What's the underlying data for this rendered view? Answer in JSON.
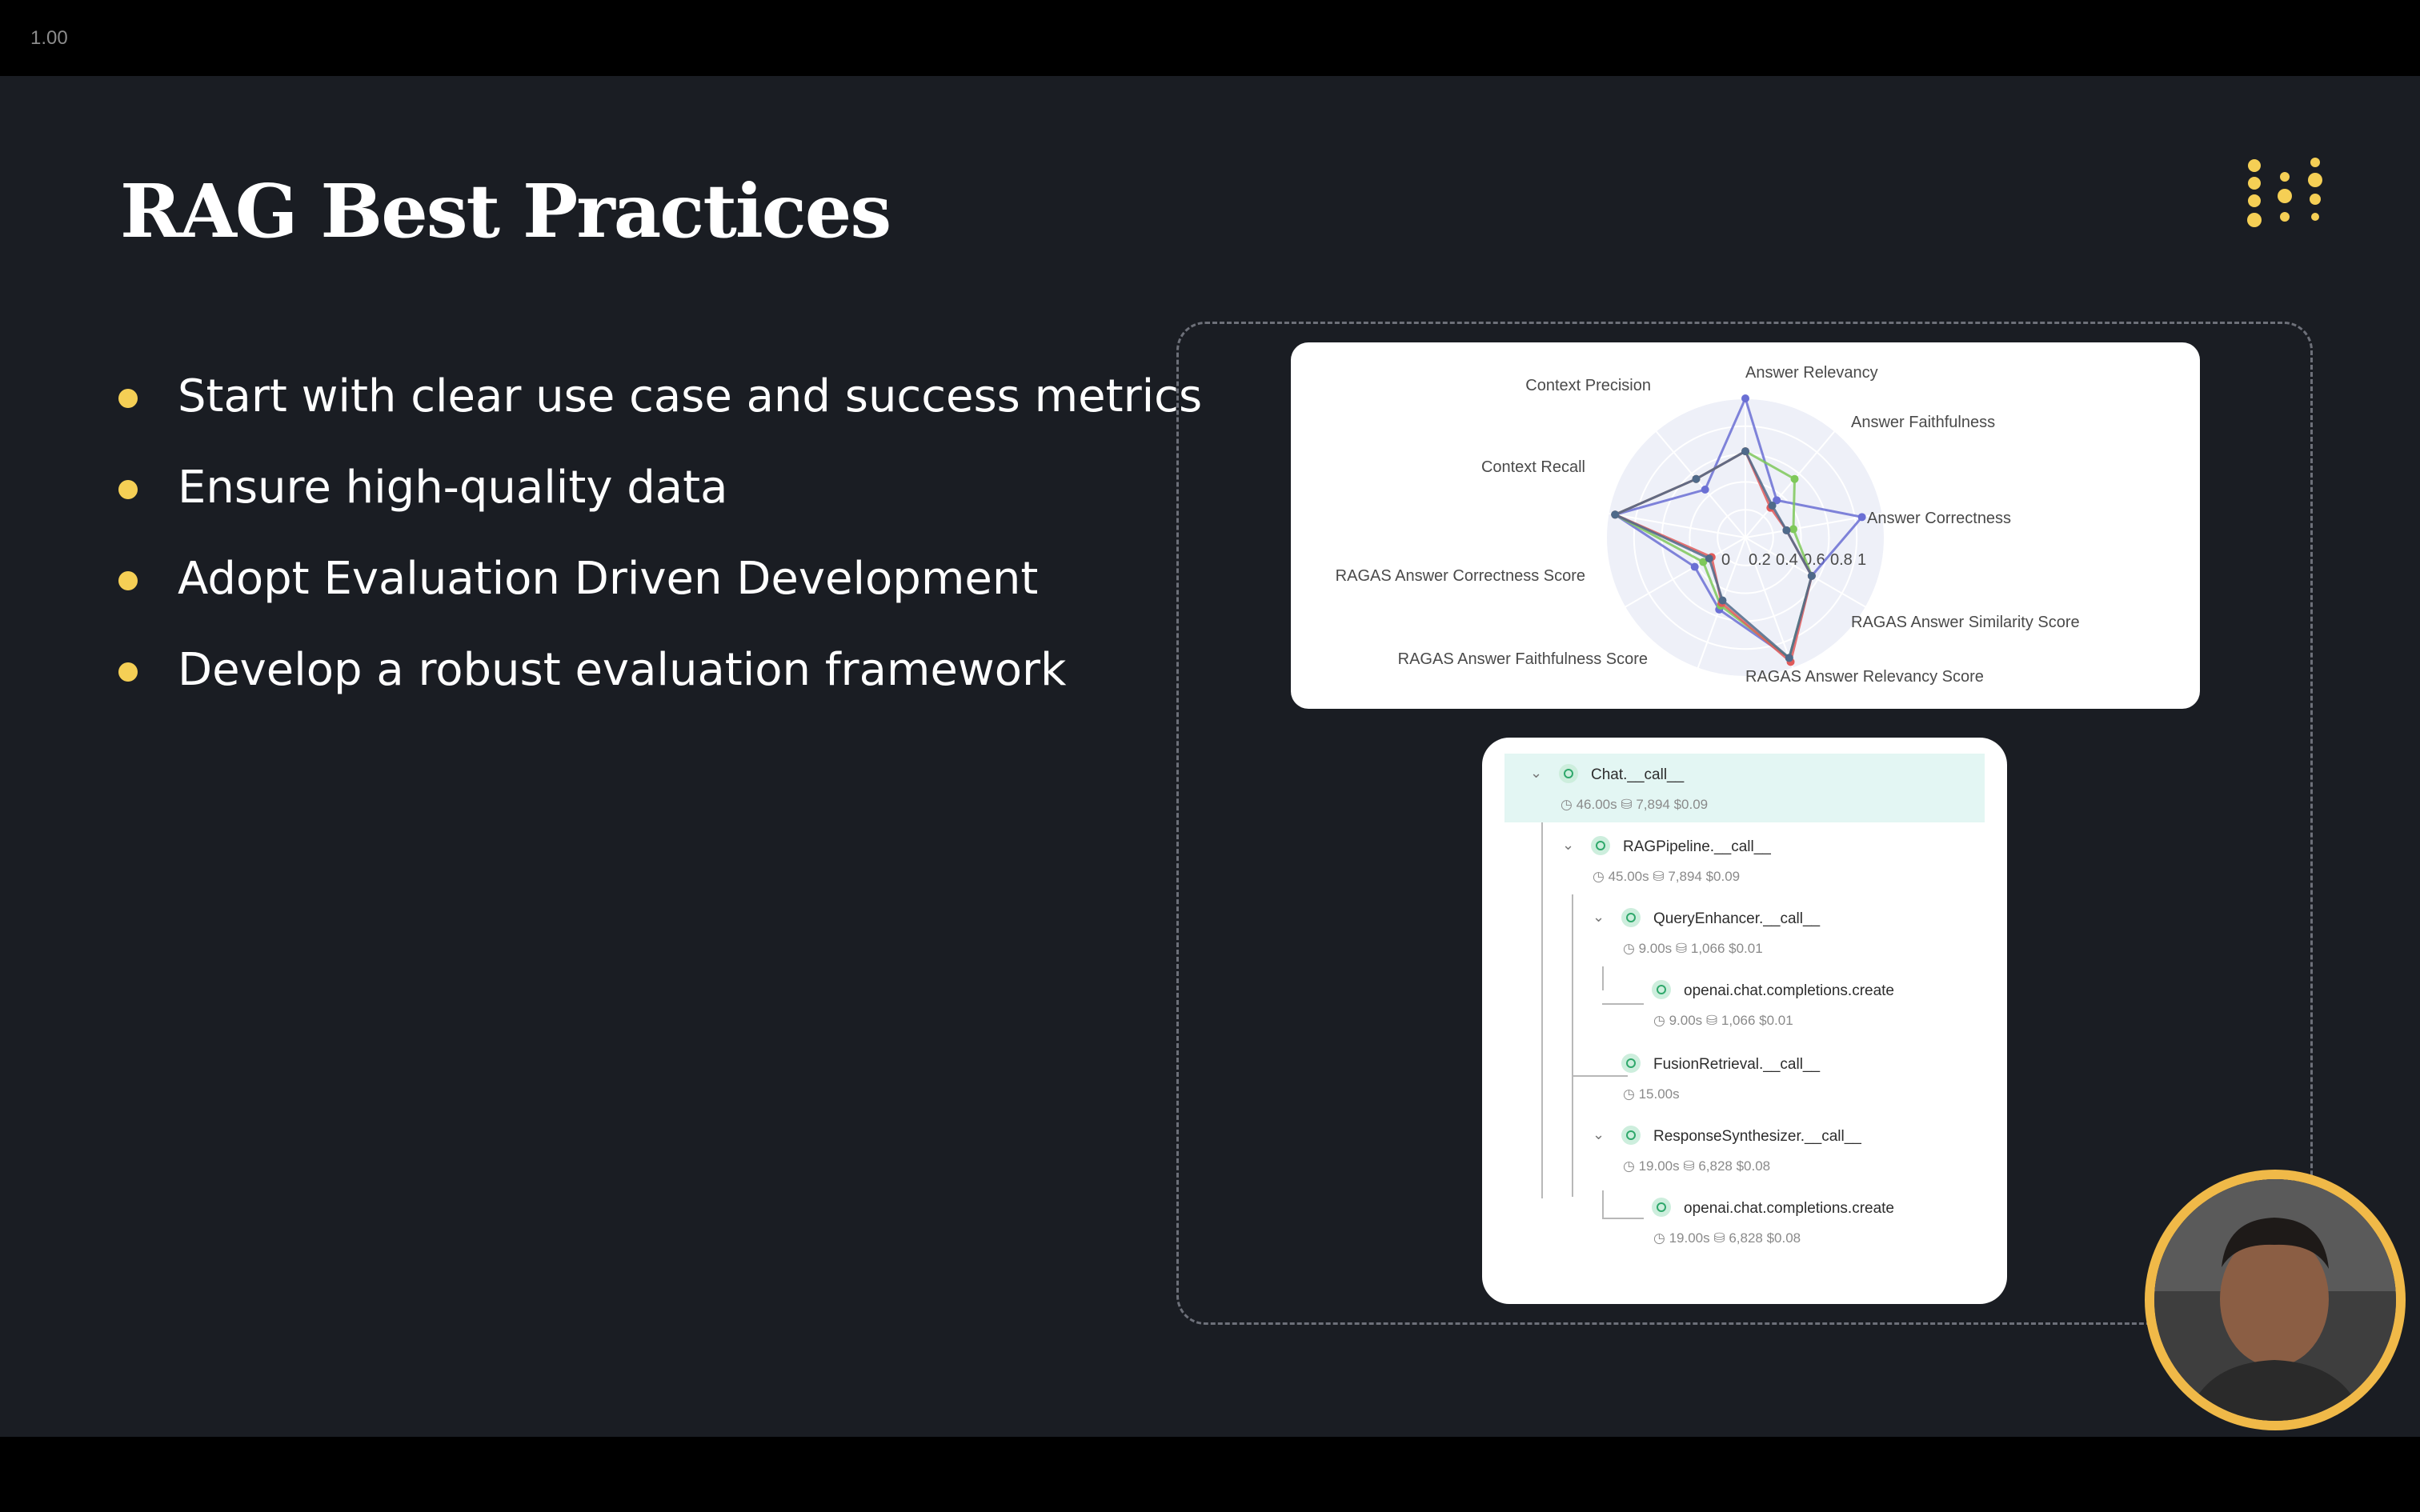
{
  "toolbar": {
    "zoom": "1.00"
  },
  "slide": {
    "title": "RAG Best Practices",
    "bullets": [
      "Start with clear use case and success metrics",
      "Ensure high-quality data",
      "Adopt Evaluation Driven Development",
      "Develop a robust evaluation framework"
    ]
  },
  "chart_data": {
    "type": "radar",
    "axes": [
      "Answer Relevancy",
      "Answer Faithfulness",
      "Answer Correctness",
      "RAGAS Answer Similarity Score",
      "RAGAS Answer Relevancy Score",
      "RAGAS Answer Faithfulness Score",
      "RAGAS Answer Correctness Score",
      "Context Recall",
      "Context Precision"
    ],
    "radial_ticks": [
      "0",
      "0.2",
      "0.4",
      "0.6",
      "0.8",
      "1"
    ],
    "range": [
      0,
      1
    ],
    "series": [
      {
        "color": "#6a6fd4",
        "values": [
          1.0,
          0.35,
          0.85,
          0.55,
          0.92,
          0.55,
          0.42,
          0.95,
          0.45
        ]
      },
      {
        "color": "#7ec85a",
        "values": [
          0.62,
          0.55,
          0.35,
          0.55,
          0.92,
          0.52,
          0.35,
          0.95,
          0.55
        ]
      },
      {
        "color": "#e05a5a",
        "values": [
          0.62,
          0.28,
          0.3,
          0.55,
          0.95,
          0.5,
          0.28,
          0.95,
          0.55
        ]
      },
      {
        "color": "#4f6a8a",
        "values": [
          0.62,
          0.3,
          0.3,
          0.55,
          0.92,
          0.48,
          0.3,
          0.95,
          0.55
        ]
      }
    ],
    "grid": true
  },
  "trace": {
    "rows": [
      {
        "name": "Chat.__call__",
        "duration": "46.00s",
        "tokens": "7,894",
        "cost": "$0.09",
        "expandable": true,
        "highlight": true
      },
      {
        "name": "RAGPipeline.__call__",
        "duration": "45.00s",
        "tokens": "7,894",
        "cost": "$0.09",
        "expandable": true
      },
      {
        "name": "QueryEnhancer.__call__",
        "duration": "9.00s",
        "tokens": "1,066",
        "cost": "$0.01",
        "expandable": true
      },
      {
        "name": "openai.chat.completions.create",
        "duration": "9.00s",
        "tokens": "1,066",
        "cost": "$0.01"
      },
      {
        "name": "FusionRetrieval.__call__",
        "duration": "15.00s"
      },
      {
        "name": "ResponseSynthesizer.__call__",
        "duration": "19.00s",
        "tokens": "6,828",
        "cost": "$0.08",
        "expandable": true
      },
      {
        "name": "openai.chat.completions.create",
        "duration": "19.00s",
        "tokens": "6,828",
        "cost": "$0.08"
      }
    ]
  },
  "colors": {
    "accent": "#f5cf55",
    "background": "#1a1d23"
  },
  "icons": [
    "logo-dots-icon",
    "clock-icon",
    "database-icon",
    "chevron-down-icon",
    "status-ok-icon"
  ]
}
